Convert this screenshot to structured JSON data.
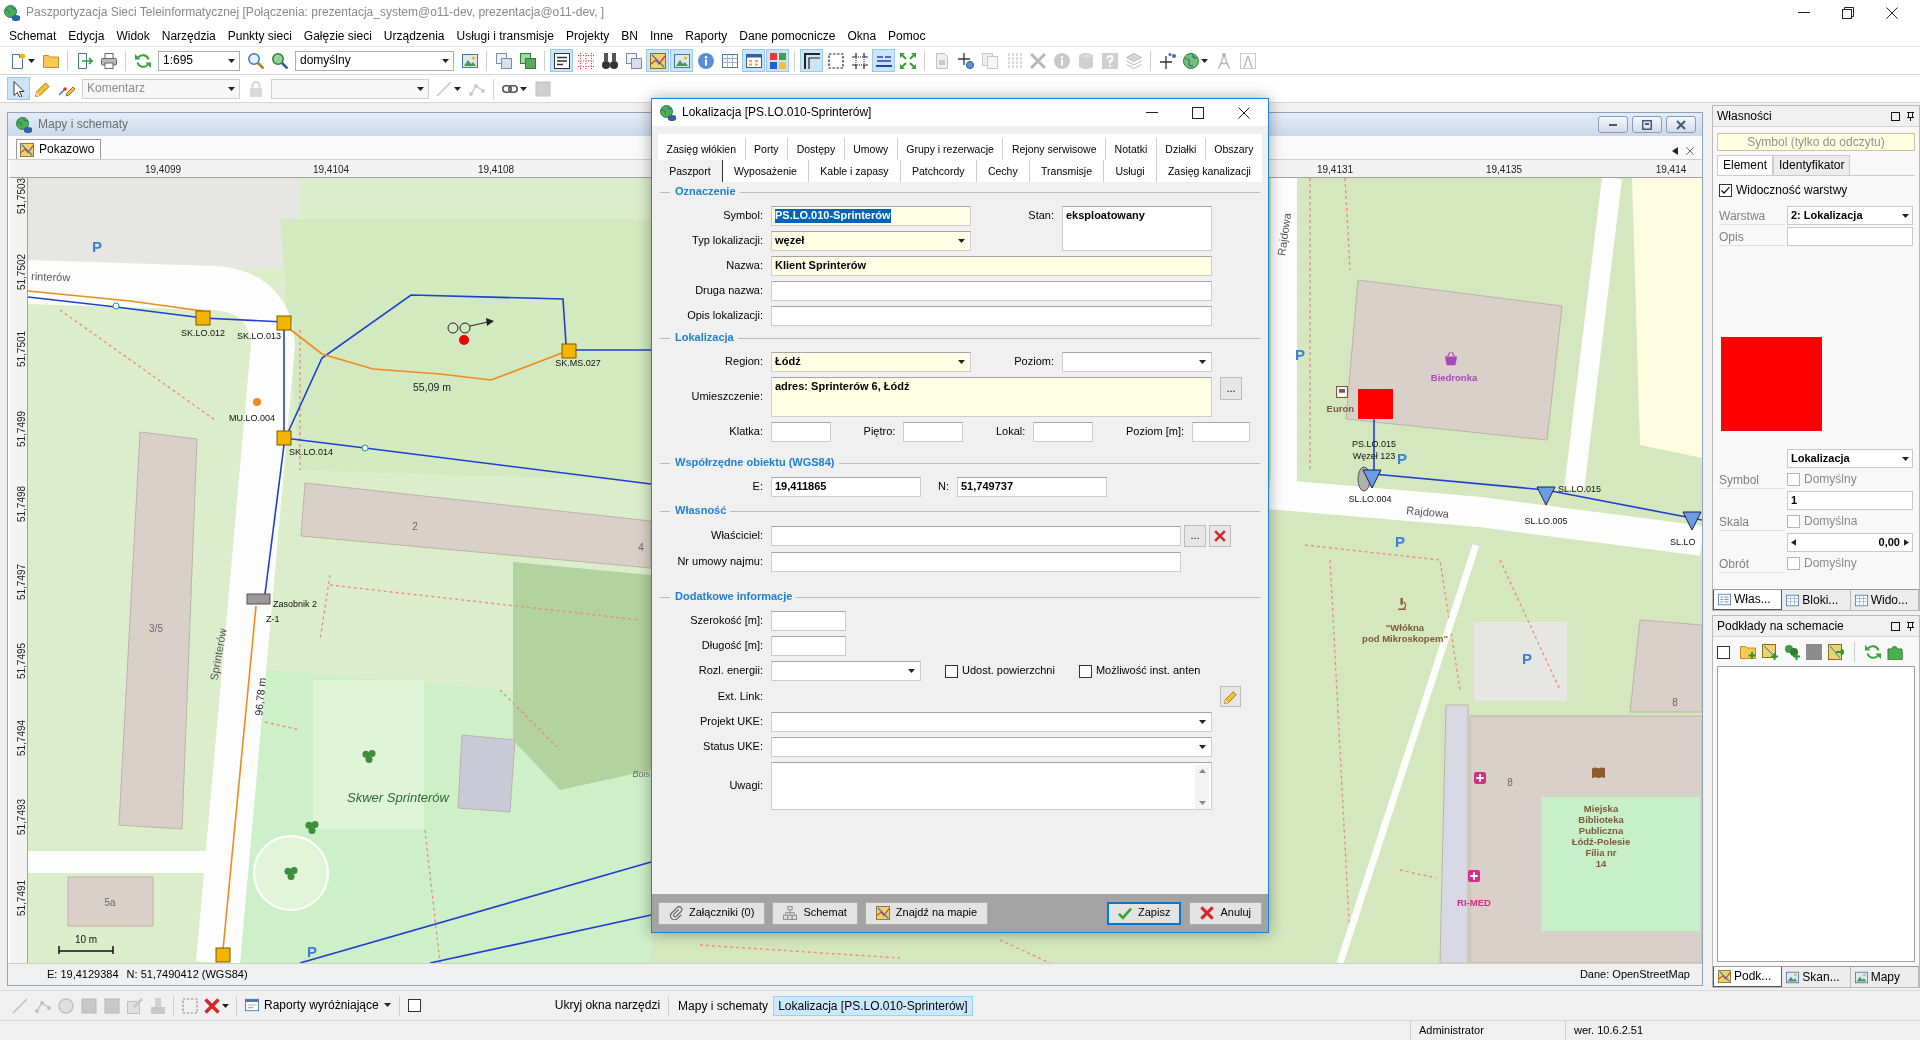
{
  "window": {
    "title": "Paszportyzacja Sieci Teleinformatycznej [Połączenia: prezentacja_system@o11-dev, prezentacja@o11-dev, ]"
  },
  "menu": [
    "Schemat",
    "Edycja",
    "Widok",
    "Narzędzia",
    "Punkty sieci",
    "Gałęzie sieci",
    "Urządzenia",
    "Usługi i transmisje",
    "Projekty",
    "BN",
    "Inne",
    "Raporty",
    "Dane pomocnicze",
    "Okna",
    "Pomoc"
  ],
  "toolbar": {
    "scale": "1:695",
    "view": "domyślny",
    "buttons": [
      {
        "pressed": false,
        "disabled": false
      },
      {
        "pressed": false,
        "disabled": false
      },
      {
        "pressed": false,
        "disabled": false
      },
      {
        "pressed": false,
        "disabled": false
      },
      {
        "pressed": false,
        "disabled": false
      },
      {
        "pressed": false,
        "disabled": false
      },
      {
        "pressed": false,
        "disabled": false
      },
      {
        "pressed": false,
        "disabled": false
      },
      {
        "pressed": false,
        "disabled": false
      },
      {
        "pressed": false,
        "disabled": false
      },
      {
        "pressed": true,
        "disabled": false
      },
      {
        "pressed": false,
        "disabled": false
      },
      {
        "pressed": false,
        "disabled": false
      },
      {
        "pressed": false,
        "disabled": false
      },
      {
        "pressed": true,
        "disabled": false
      },
      {
        "pressed": true,
        "disabled": false
      },
      {
        "pressed": false,
        "disabled": false
      },
      {
        "pressed": false,
        "disabled": false
      },
      {
        "pressed": true,
        "disabled": false
      },
      {
        "pressed": true,
        "disabled": false
      },
      {
        "pressed": true,
        "disabled": false
      },
      {
        "pressed": false,
        "disabled": false
      },
      {
        "pressed": false,
        "disabled": false
      },
      {
        "pressed": true,
        "disabled": false
      },
      {
        "pressed": false,
        "disabled": false
      },
      {
        "pressed": false,
        "disabled": true
      },
      {
        "pressed": false,
        "disabled": false
      },
      {
        "pressed": false,
        "disabled": true
      },
      {
        "pressed": false,
        "disabled": true
      },
      {
        "pressed": false,
        "disabled": true
      },
      {
        "pressed": false,
        "disabled": true
      },
      {
        "pressed": false,
        "disabled": true
      },
      {
        "pressed": false,
        "disabled": true
      },
      {
        "pressed": false,
        "disabled": true
      },
      {
        "pressed": false,
        "disabled": false
      },
      {
        "pressed": false,
        "disabled": false
      },
      {
        "pressed": false,
        "disabled": true
      },
      {
        "pressed": false,
        "disabled": true
      }
    ]
  },
  "toolbar2": {
    "comment": {
      "value": "Komentarz",
      "disabled": true
    },
    "style": {
      "disabled": true
    },
    "buttons": [
      {
        "pressed": true,
        "disabled": false
      },
      {
        "pressed": false,
        "disabled": false
      },
      {
        "pressed": false,
        "disabled": false
      },
      {
        "pressed": false,
        "disabled": true
      },
      {
        "pressed": false,
        "disabled": true
      },
      {
        "pressed": false,
        "disabled": true
      },
      {
        "pressed": false,
        "disabled": false
      },
      {
        "pressed": false,
        "disabled": true
      }
    ]
  },
  "map_window": {
    "title": "Mapy i schematy",
    "tabs": [
      {
        "label": "Pokazowo",
        "selected": true
      }
    ],
    "x_ticks": [
      "19,4099",
      "19,4104",
      "19,4108",
      "19,4131",
      "19,4135",
      "19,414"
    ],
    "y_ticks": [
      "51,7503",
      "51,7502",
      "51,7501",
      "51,7499",
      "51,7498",
      "51,7497",
      "51,7495",
      "51,7494",
      "51,7493",
      "51,7491"
    ],
    "labels": [
      {
        "kind": "parking",
        "text": "P"
      },
      {
        "kind": "street",
        "text": "rinterów"
      },
      {
        "kind": "node",
        "text": "SK.LO.012"
      },
      {
        "kind": "node",
        "text": "SK.LO.013"
      },
      {
        "kind": "node",
        "text": "SK.MS.027"
      },
      {
        "kind": "node",
        "text": "MU.LO.004"
      },
      {
        "kind": "node",
        "text": "SK.LO.014"
      },
      {
        "kind": "measure",
        "text": "55,09 m"
      },
      {
        "kind": "node",
        "text": "Zasobnik 2"
      },
      {
        "kind": "node",
        "text": "Z-1"
      },
      {
        "kind": "measure",
        "text": "96,78 m"
      },
      {
        "kind": "street",
        "text": "Sprinterów"
      },
      {
        "kind": "building",
        "text": "3/5"
      },
      {
        "kind": "building",
        "text": "2"
      },
      {
        "kind": "building",
        "text": "5a"
      },
      {
        "kind": "area",
        "text": "Skwer Sprinterów"
      },
      {
        "kind": "street",
        "text": "Rajdowa"
      },
      {
        "kind": "poi",
        "text": "Biedronka",
        "color": "#ab47bc"
      },
      {
        "kind": "poi",
        "text": "Euron",
        "color": "#7b5b3a"
      },
      {
        "kind": "node",
        "text": "PS.LO.015"
      },
      {
        "kind": "node",
        "text": "Węzeł 123"
      },
      {
        "kind": "node",
        "text": "SL.LO.004"
      },
      {
        "kind": "node",
        "text": "SL.LO.015"
      },
      {
        "kind": "node",
        "text": "SL.LO.005"
      },
      {
        "kind": "street",
        "text": "Rajdowa"
      },
      {
        "kind": "node",
        "text": "SL.LO"
      },
      {
        "kind": "parking",
        "text": "P"
      },
      {
        "kind": "parking",
        "text": "P"
      },
      {
        "kind": "parking",
        "text": "P"
      },
      {
        "kind": "parking",
        "text": "P"
      },
      {
        "kind": "poi",
        "lines": [
          "\"Włókna",
          "pod Mikroskopem\""
        ],
        "color": "#7b5b3a"
      },
      {
        "kind": "poi",
        "lines": [
          "Miejska",
          "Biblioteka",
          "Publiczna",
          "Łódź-Polesie",
          "Filia nr",
          "14"
        ],
        "color": "#7b5b3a"
      },
      {
        "kind": "poi",
        "text": "RI-MED",
        "color": "#d0308a"
      },
      {
        "kind": "building",
        "text": "8"
      },
      {
        "kind": "building",
        "text": "8"
      },
      {
        "kind": "parking",
        "text": "P"
      },
      {
        "kind": "building",
        "text": "4"
      },
      {
        "kind": "place",
        "text": "Bois"
      }
    ],
    "scale_label": "10 m",
    "coordinates": [
      "E: 19,4129384",
      "N: 51,7490412 (WGS84)"
    ],
    "source": "Dane: OpenStreetMap"
  },
  "dialog": {
    "title": "Lokalizacja [PS.LO.010-Sprinterów]",
    "tab_rows": [
      [
        {
          "label": "Zasięg włókien",
          "selected": false
        },
        {
          "label": "Porty",
          "selected": false
        },
        {
          "label": "Dostępy",
          "selected": false
        },
        {
          "label": "Umowy",
          "selected": false
        },
        {
          "label": "Grupy i rezerwacje",
          "selected": false
        },
        {
          "label": "Rejony serwisowe",
          "selected": false
        },
        {
          "label": "Notatki",
          "selected": false
        },
        {
          "label": "Działki",
          "selected": false
        },
        {
          "label": "Obszary",
          "selected": false
        }
      ],
      [
        {
          "label": "Paszport",
          "selected": true
        },
        {
          "label": "Wyposażenie",
          "selected": false
        },
        {
          "label": "Kable i zapasy",
          "selected": false
        },
        {
          "label": "Patchcordy",
          "selected": false
        },
        {
          "label": "Cechy",
          "selected": false
        },
        {
          "label": "Transmisje",
          "selected": false
        },
        {
          "label": "Usługi",
          "selected": false
        },
        {
          "label": "Zasięg kanalizacji",
          "selected": false
        }
      ]
    ],
    "sections": [
      {
        "title": "Oznaczenie",
        "rows": [
          [
            {
              "kind": "text",
              "label": "Symbol:",
              "value": "PS.LO.010-Sprinterów",
              "required": true,
              "text_selected": true
            },
            {
              "kind": "memo",
              "label": "Stan:",
              "value": "eksploatowany",
              "required": false
            }
          ],
          [
            {
              "kind": "combo",
              "label": "Typ lokalizacji:",
              "value": "węzeł",
              "required": true
            }
          ],
          [
            {
              "kind": "text",
              "label": "Nazwa:",
              "value": "Klient Sprinterów",
              "required": true
            }
          ],
          [
            {
              "kind": "text",
              "label": "Druga nazwa:",
              "required": false
            }
          ],
          [
            {
              "kind": "text",
              "label": "Opis lokalizacji:",
              "required": false
            }
          ]
        ]
      },
      {
        "title": "Lokalizacja",
        "rows": [
          [
            {
              "kind": "combo",
              "label": "Region:",
              "value": "Łódź",
              "required": true
            },
            {
              "kind": "combo",
              "label": "Poziom:",
              "required": false
            }
          ],
          [
            {
              "kind": "memo",
              "label": "Umieszczenie:",
              "value": "adres: Sprinterów 6, Łódź",
              "required": true,
              "button": "..."
            }
          ],
          [
            {
              "kind": "text",
              "label": "Klatka:",
              "required": false
            },
            {
              "kind": "text",
              "label": "Piętro:",
              "required": false
            },
            {
              "kind": "text",
              "label": "Lokal:",
              "required": false
            },
            {
              "kind": "text",
              "label": "Poziom [m]:",
              "required": false
            }
          ]
        ]
      },
      {
        "title": "Współrzędne obiektu (WGS84)",
        "rows": [
          [
            {
              "kind": "text",
              "label": "E:",
              "value": "19,411865",
              "required": false
            },
            {
              "kind": "text",
              "label": "N:",
              "value": "51,749737",
              "required": false
            }
          ]
        ]
      },
      {
        "title": "Własność",
        "rows": [
          [
            {
              "kind": "text",
              "label": "Właściciel:",
              "required": false,
              "button": "...",
              "clearable": true
            }
          ],
          [
            {
              "kind": "text",
              "label": "Nr umowy najmu:",
              "required": false
            }
          ]
        ]
      },
      {
        "title": "Dodatkowe informacje",
        "rows": [
          [
            {
              "kind": "text",
              "label": "Szerokość [m]:",
              "required": false
            }
          ],
          [
            {
              "kind": "text",
              "label": "Długość [m]:",
              "required": false
            }
          ],
          [
            {
              "kind": "combo",
              "label": "Rozl. energii:",
              "required": false
            },
            {
              "kind": "checkbox",
              "label": "Udost. powierzchni",
              "checked": false
            },
            {
              "kind": "checkbox",
              "label": "Możliwość inst. anten",
              "checked": false
            }
          ],
          [
            {
              "kind": "link",
              "label": "Ext. Link:"
            }
          ],
          [
            {
              "kind": "combo",
              "label": "Projekt UKE:",
              "required": false
            }
          ],
          [
            {
              "kind": "combo",
              "label": "Status UKE:",
              "required": false
            }
          ],
          [
            {
              "kind": "memo",
              "label": "Uwagi:",
              "required": false,
              "scrollbar": true
            }
          ]
        ]
      }
    ],
    "left_buttons": [
      {
        "label": "Załączniki (0)"
      },
      {
        "label": "Schemat"
      },
      {
        "label": "Znajdź na mapie"
      }
    ],
    "right_buttons": [
      {
        "label": "Zapisz",
        "default": true
      },
      {
        "label": "Anuluj",
        "default": false
      }
    ]
  },
  "properties": {
    "title": "Własności",
    "caption": "Symbol (tylko do odczytu)",
    "tabs": [
      {
        "label": "Element",
        "selected": true
      },
      {
        "label": "Identyfikator",
        "selected": false
      }
    ],
    "visibility": {
      "label": "Widoczność warstwy",
      "checked": true
    },
    "layer": {
      "label": "Warstwa",
      "value": "2: Lokalizacja"
    },
    "description": {
      "label": "Opis"
    },
    "color": "#ff0000",
    "style_rows": [
      {
        "kind": "combo",
        "value": "Lokalizacja"
      },
      {
        "kind": "checkbox",
        "label": "Symbol",
        "option": "Domyślny",
        "checked": false,
        "disabled": true
      },
      {
        "kind": "field",
        "value": "1"
      },
      {
        "kind": "checkbox",
        "label": "Skala",
        "option": "Domyślna",
        "checked": false,
        "disabled": true
      },
      {
        "kind": "spin",
        "value": "0,00"
      },
      {
        "kind": "checkbox",
        "label": "Obrót",
        "option": "Domyślny",
        "checked": false,
        "disabled": true
      }
    ],
    "bottom_tabs": [
      {
        "label": "Włas...",
        "selected": true
      },
      {
        "label": "Bloki...",
        "selected": false
      },
      {
        "label": "Wido...",
        "selected": false
      }
    ]
  },
  "layers": {
    "title": "Podkłady na schemacie",
    "select_all": {
      "checked": false
    },
    "bottom_tabs": [
      {
        "label": "Podk...",
        "selected": true
      },
      {
        "label": "Skan...",
        "selected": false
      },
      {
        "label": "Mapy",
        "selected": false
      }
    ]
  },
  "bottom_toolbar": {
    "buttons": [
      {
        "disabled": true
      },
      {
        "disabled": true
      },
      {
        "disabled": true
      },
      {
        "disabled": true
      },
      {
        "disabled": true
      },
      {
        "disabled": true
      },
      {
        "disabled": true
      },
      {
        "disabled": true
      },
      {
        "disabled": false
      }
    ],
    "reports": "Raporty wyróżniające",
    "toggle": {
      "checked": false
    },
    "hide_tools": "Ukryj okna narzędzi",
    "windows": [
      {
        "label": "Mapy i schematy",
        "selected": false
      },
      {
        "label": "Lokalizacja [PS.LO.010-Sprinterów]",
        "selected": true
      }
    ]
  },
  "status_bar": {
    "user": "Administrator",
    "version": "wer. 10.6.2.51"
  }
}
